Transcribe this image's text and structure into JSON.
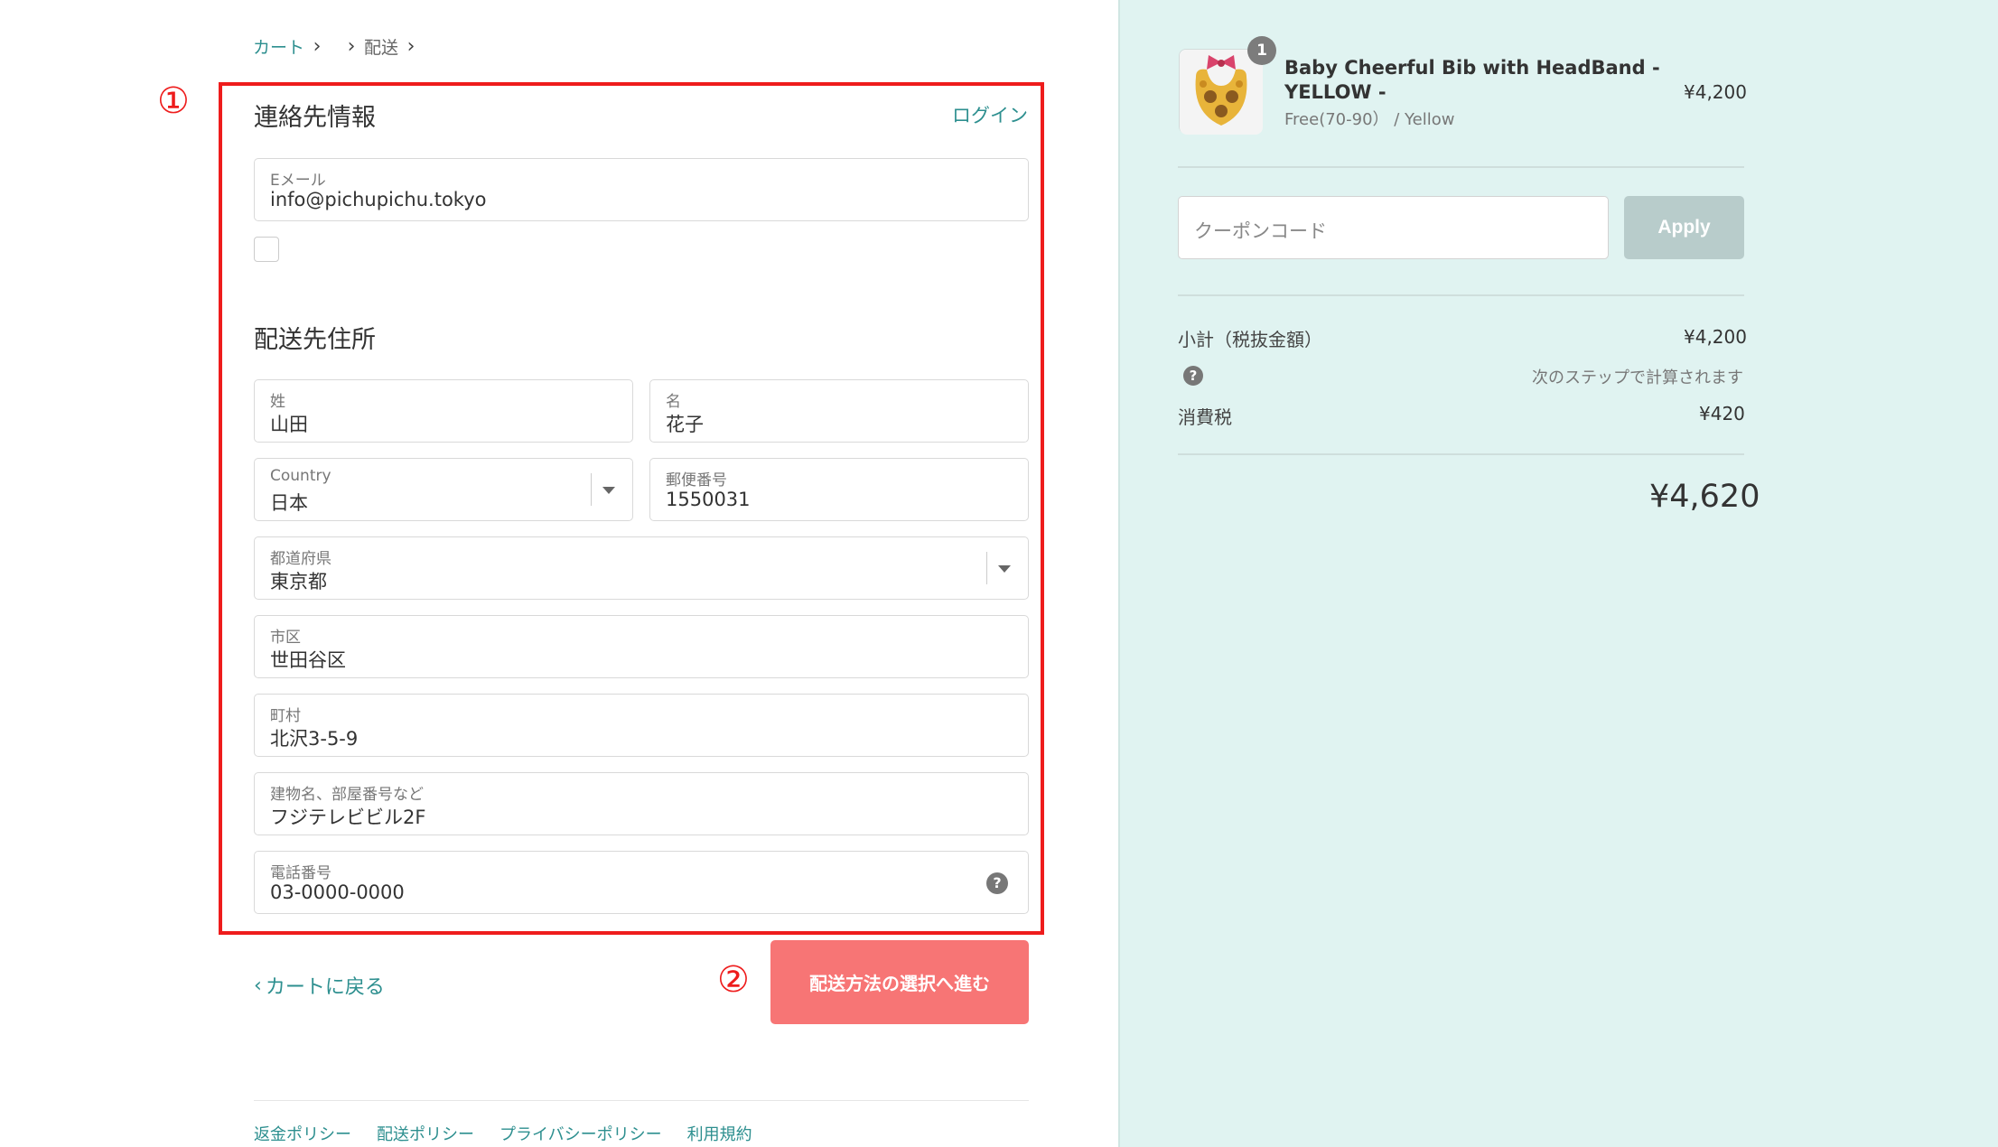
{
  "breadcrumb": {
    "cart": "カート",
    "shipping": "配送"
  },
  "annotations": {
    "one": "①",
    "two": "②"
  },
  "contact": {
    "title": "連絡先情報",
    "login": "ログイン",
    "email_label": "Eメール",
    "email_value": "info@pichupichu.tokyo"
  },
  "shipping": {
    "title": "配送先住所",
    "last_name_label": "姓",
    "last_name_value": "山田",
    "first_name_label": "名",
    "first_name_value": "花子",
    "country_label": "Country",
    "country_value": "日本",
    "postal_label": "郵便番号",
    "postal_value": "1550031",
    "prefecture_label": "都道府県",
    "prefecture_value": "東京都",
    "city_label": "市区",
    "city_value": "世田谷区",
    "town_label": "町村",
    "town_value": "北沢3-5-9",
    "building_label": "建物名、部屋番号など",
    "building_value": "フジテレビビル2F",
    "phone_label": "電話番号",
    "phone_value": "03-0000-0000"
  },
  "actions": {
    "back": "カートに戻る",
    "continue": "配送方法の選択へ進む"
  },
  "footer": {
    "links": [
      "返金ポリシー",
      "配送ポリシー",
      "プライバシーポリシー",
      "利用規約"
    ]
  },
  "order": {
    "quantity": "1",
    "product_name_line1": "Baby Cheerful Bib with HeadBand -",
    "product_name_line2": "YELLOW -",
    "variant": "Free(70-90） / Yellow",
    "price": "¥4,200",
    "coupon_placeholder": "クーポンコード",
    "apply": "Apply",
    "subtotal_label": "小計（税抜金額）",
    "subtotal_value": "¥4,200",
    "shipping_note": "次のステップで計算されます",
    "tax_label": "消費税",
    "tax_value": "¥420",
    "total": "¥4,620"
  },
  "colors": {
    "accent": "#2d8f8f",
    "cta": "#f77575",
    "annotation": "#ee1c1c",
    "sidebar_bg": "#e0f3f1"
  }
}
